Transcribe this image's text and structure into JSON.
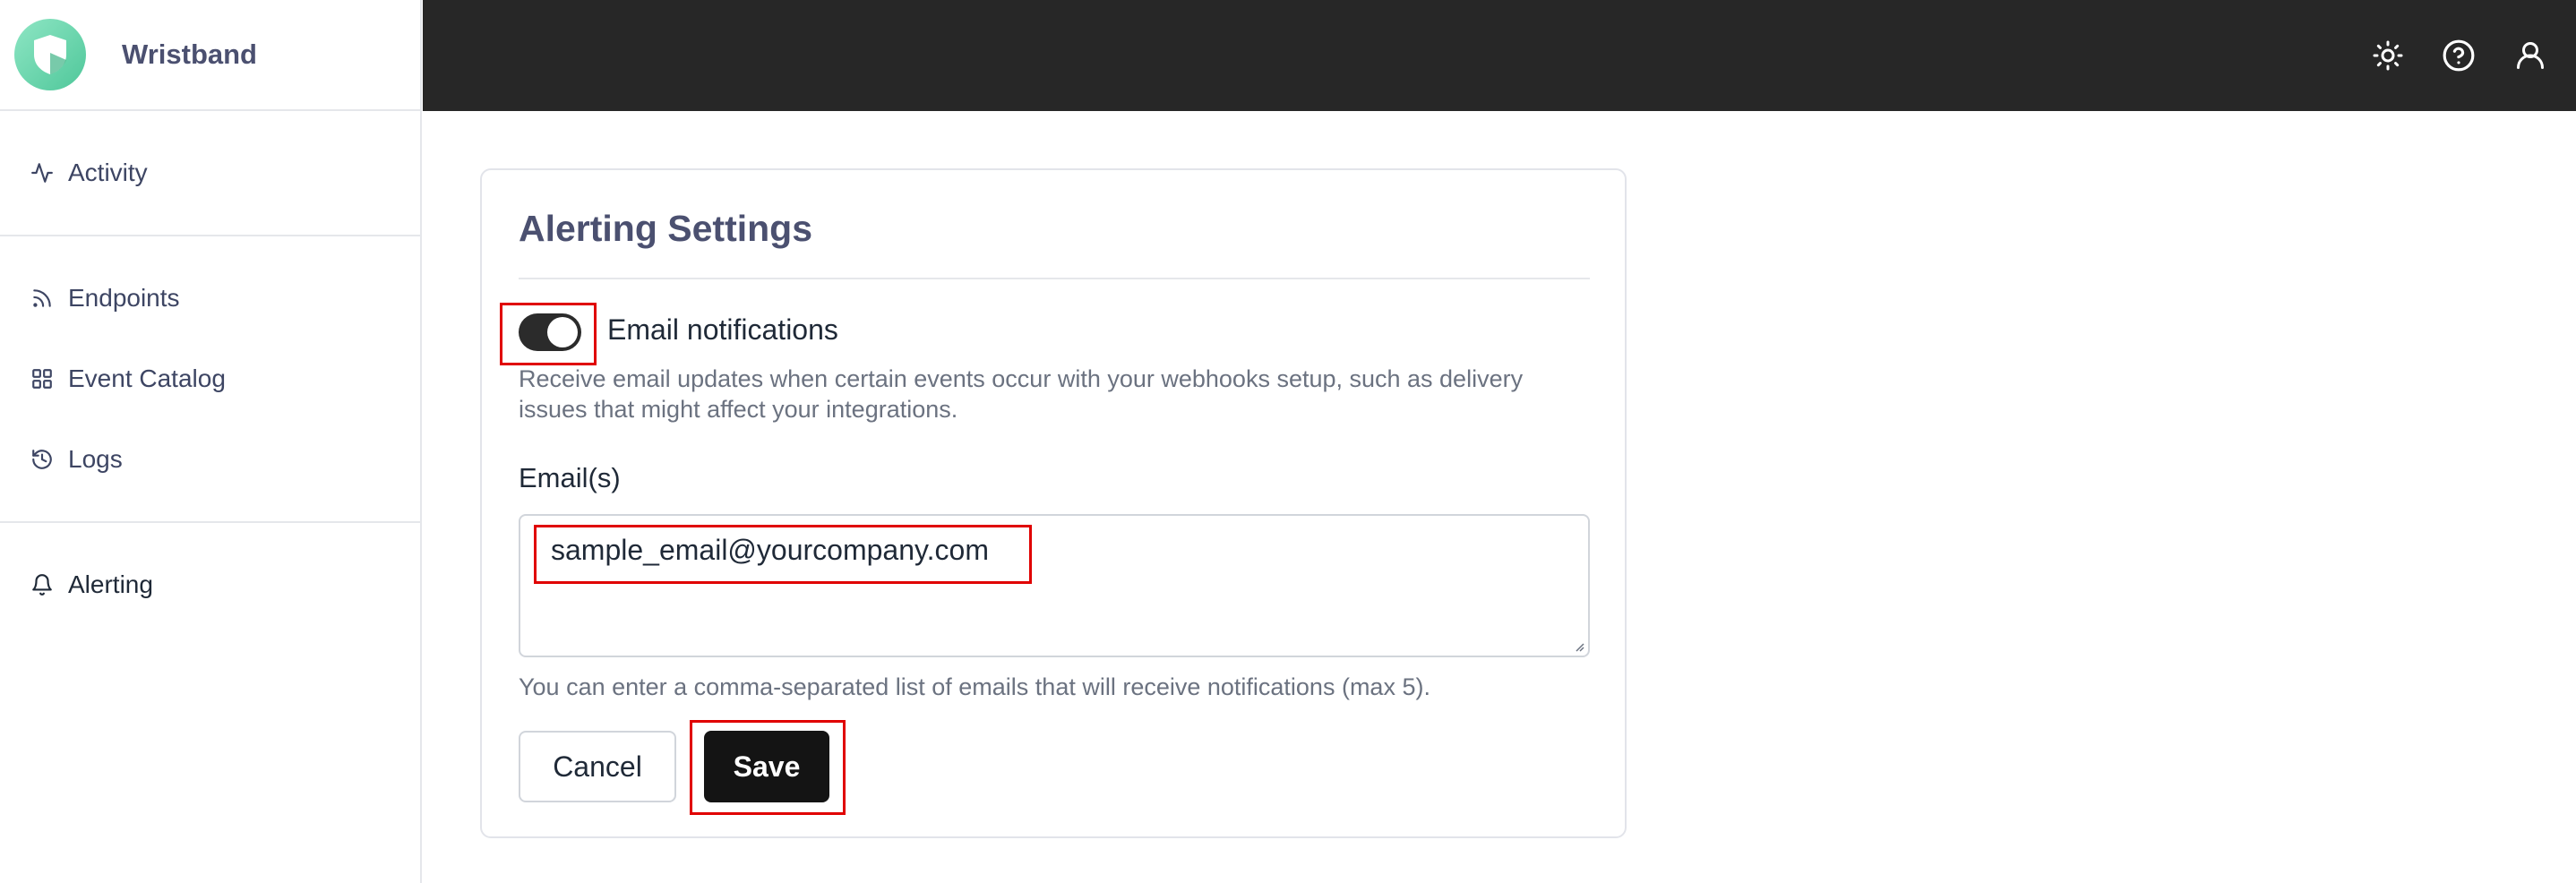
{
  "app": {
    "name": "Wristband"
  },
  "sidebar": {
    "groups": [
      [
        {
          "label": "Activity",
          "icon": "activity-icon"
        }
      ],
      [
        {
          "label": "Endpoints",
          "icon": "rss-icon"
        },
        {
          "label": "Event Catalog",
          "icon": "grid-icon"
        },
        {
          "label": "Logs",
          "icon": "history-icon"
        }
      ],
      [
        {
          "label": "Alerting",
          "icon": "bell-icon",
          "active": true
        }
      ]
    ]
  },
  "topbar": {
    "icons": [
      "sun-icon",
      "help-circle-icon",
      "user-icon"
    ]
  },
  "card": {
    "title": "Alerting Settings",
    "toggle": {
      "label": "Email notifications",
      "on": true
    },
    "toggle_description": "Receive email updates when certain events occur with your webhooks setup, such as delivery issues that might affect your integrations.",
    "emails_label": "Email(s)",
    "emails_value": "sample_email@yourcompany.com",
    "hint": "You can enter a comma-separated list of emails that will receive notifications (max 5).",
    "cancel_label": "Cancel",
    "save_label": "Save"
  },
  "colors": {
    "accent": "#141414",
    "highlight": "#e00000",
    "topbar": "#272727",
    "brand": "#4fc79a"
  }
}
